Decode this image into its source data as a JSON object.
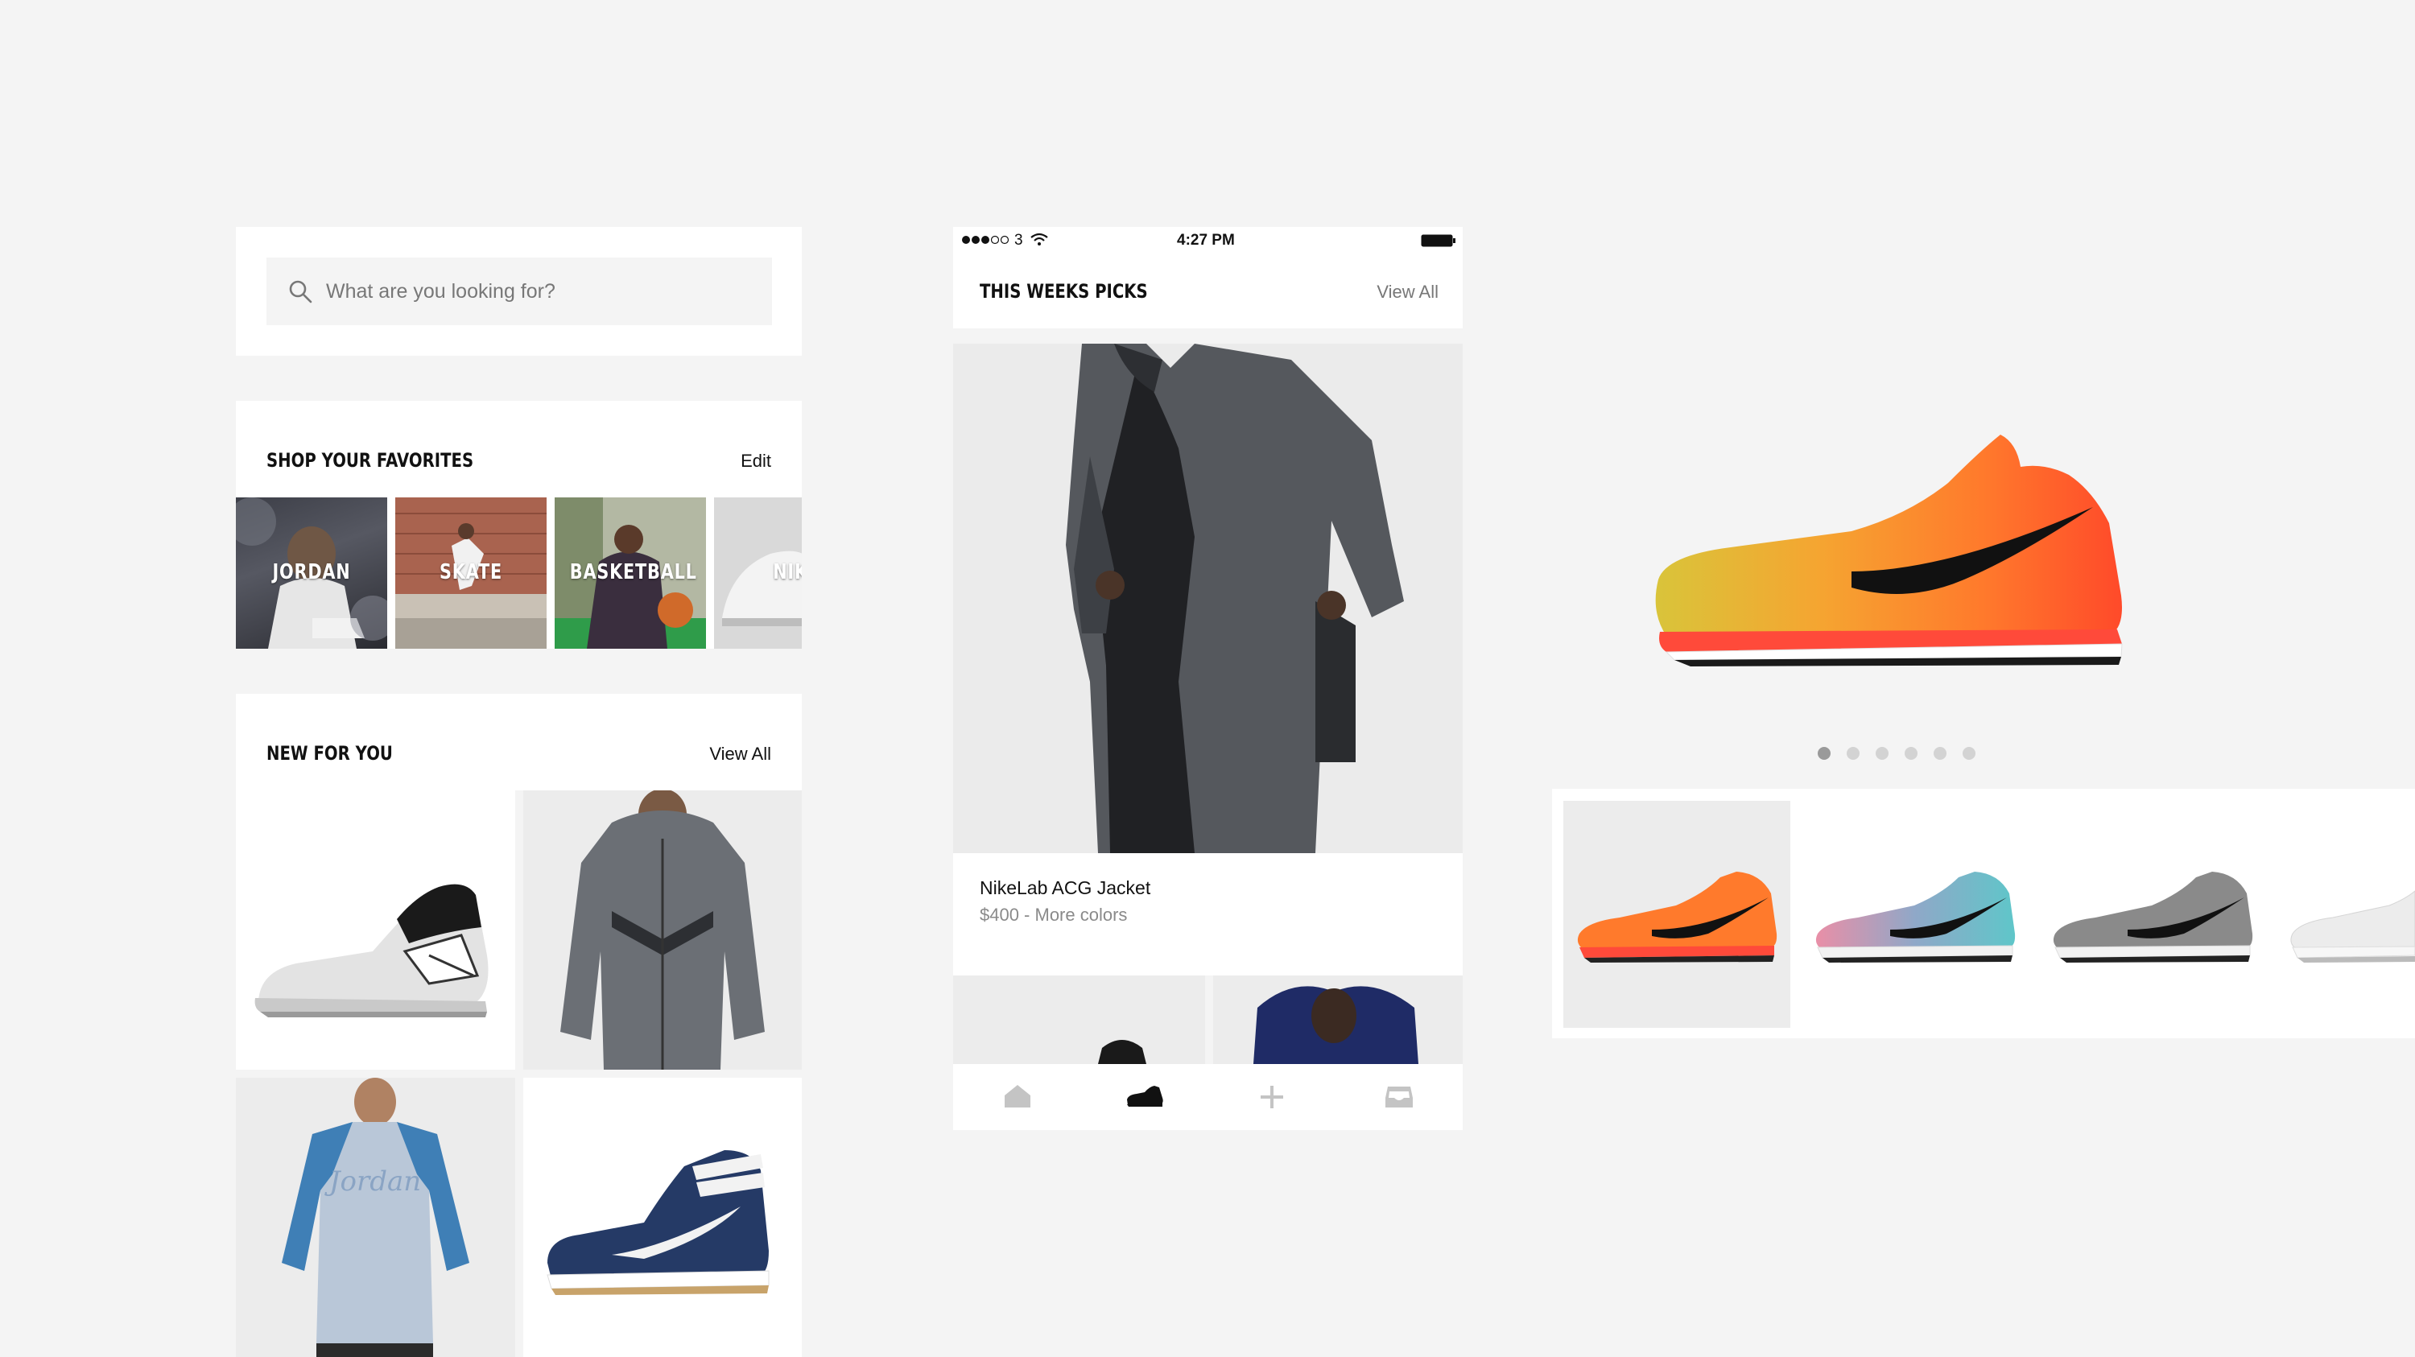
{
  "search": {
    "placeholder": "What are you looking for?"
  },
  "favorites": {
    "title": "SHOP YOUR FAVORITES",
    "edit_label": "Edit",
    "tiles": [
      "JORDAN",
      "SKATE",
      "BASKETBALL",
      "NIKE"
    ]
  },
  "new_for_you": {
    "title": "NEW FOR YOU",
    "view_all": "View All"
  },
  "phone": {
    "status": {
      "carrier": "3",
      "time": "4:27 PM"
    },
    "section_title": "THIS WEEKS PICKS",
    "view_all": "View All",
    "featured": {
      "name": "NikeLab ACG Jacket",
      "meta": "$400 - More colors"
    },
    "tabs": [
      "home-icon",
      "shoe-icon",
      "plus-icon",
      "inbox-icon"
    ]
  },
  "product": {
    "carousel_count": 6,
    "carousel_active": 1,
    "colors": {
      "accent": "#ff5a2a",
      "shoe_alt": "#5fc6c9"
    }
  }
}
